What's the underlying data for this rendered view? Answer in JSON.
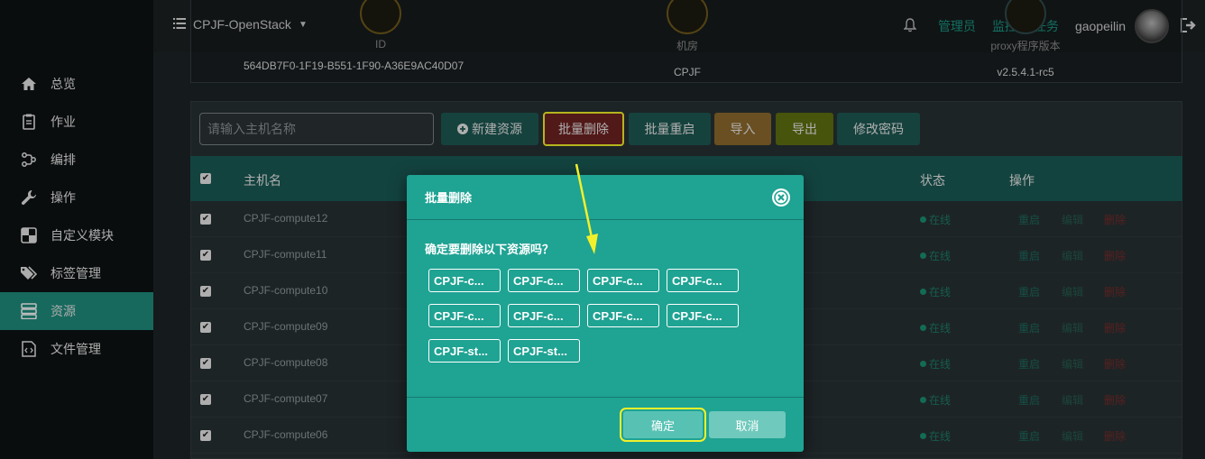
{
  "topbar": {
    "project": "CPJF-OpenStack",
    "links": [
      "管理员",
      "监控",
      "任务"
    ],
    "username": "gaopeilin"
  },
  "sidebar": {
    "items": [
      {
        "label": "总览",
        "icon": "home-icon"
      },
      {
        "label": "作业",
        "icon": "clipboard-icon"
      },
      {
        "label": "编排",
        "icon": "orchestrate-icon"
      },
      {
        "label": "操作",
        "icon": "wrench-icon"
      },
      {
        "label": "自定义模块",
        "icon": "module-icon"
      },
      {
        "label": "标签管理",
        "icon": "tags-icon"
      },
      {
        "label": "资源",
        "icon": "server-icon"
      },
      {
        "label": "文件管理",
        "icon": "file-code-icon"
      }
    ],
    "active": "资源"
  },
  "info": {
    "id_label": "ID",
    "id_value": "564DB7F0-1F19-B551-1F90-A36E9AC40D07",
    "room_label": "机房",
    "room_value": "CPJF",
    "proxy_label": "proxy程序版本",
    "proxy_value": "v2.5.4.1-rc5"
  },
  "toolbar": {
    "search_placeholder": "请输入主机名称",
    "new_label": "新建资源",
    "batch_delete_label": "批量删除",
    "batch_restart_label": "批量重启",
    "import_label": "导入",
    "export_label": "导出",
    "change_pwd_label": "修改密码"
  },
  "table": {
    "headers": {
      "hostname": "主机名",
      "status": "状态",
      "ops": "操作"
    },
    "rows": [
      {
        "name": "CPJF-compute12",
        "status": "在线"
      },
      {
        "name": "CPJF-compute11",
        "status": "在线"
      },
      {
        "name": "CPJF-compute10",
        "status": "在线"
      },
      {
        "name": "CPJF-compute09",
        "status": "在线"
      },
      {
        "name": "CPJF-compute08",
        "status": "在线"
      },
      {
        "name": "CPJF-compute07",
        "status": "在线"
      },
      {
        "name": "CPJF-compute06",
        "status": "在线"
      }
    ],
    "actions": {
      "restart": "重启",
      "edit": "编辑",
      "delete": "删除"
    }
  },
  "modal": {
    "title": "批量删除",
    "question": "确定要删除以下资源吗？",
    "chips": [
      "CPJF-c...",
      "CPJF-c...",
      "CPJF-c...",
      "CPJF-c...",
      "CPJF-c...",
      "CPJF-c...",
      "CPJF-c...",
      "CPJF-c...",
      "CPJF-st...",
      "CPJF-st..."
    ],
    "confirm_label": "确定",
    "cancel_label": "取消"
  },
  "colors": {
    "accent": "#1fa393",
    "highlight": "#f2f02a",
    "danger": "#6e2222"
  }
}
